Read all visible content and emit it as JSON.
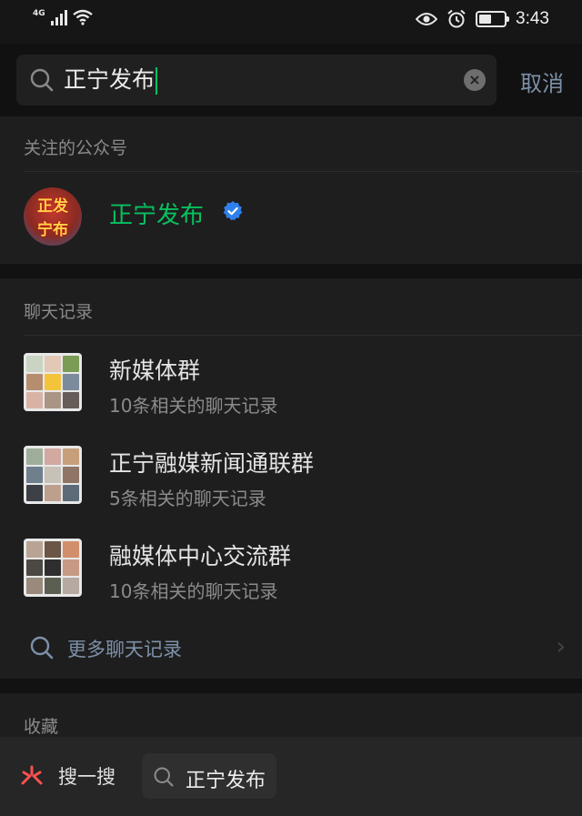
{
  "status_bar": {
    "network": "4G",
    "time": "3:43",
    "battery_level": 0.5,
    "icons": [
      "signal-icon",
      "wifi-icon",
      "eye-icon",
      "alarm-icon",
      "battery-icon"
    ]
  },
  "search": {
    "query": "正宁发布",
    "clear_icon": "clear-icon",
    "cancel_label": "取消"
  },
  "followed_accounts": {
    "title": "关注的公众号",
    "items": [
      {
        "name": "正宁发布",
        "verified": true,
        "avatar_text_top": "正发",
        "avatar_text_bottom": "宁布"
      }
    ]
  },
  "chat_history": {
    "title": "聊天记录",
    "items": [
      {
        "title": "新媒体群",
        "subtitle": "10条相关的聊天记录"
      },
      {
        "title": "正宁融媒新闻通联群",
        "subtitle": "5条相关的聊天记录"
      },
      {
        "title": "融媒体中心交流群",
        "subtitle": "10条相关的聊天记录"
      }
    ],
    "more_label": "更多聊天记录"
  },
  "favorites": {
    "title": "收藏"
  },
  "bottom_bar": {
    "sousou_label": "搜一搜",
    "query_label": "正宁发布"
  },
  "colors": {
    "accent_green": "#07c160",
    "link_blue": "#7d90a9",
    "verified_blue": "#2f80ed",
    "background": "#191919"
  }
}
